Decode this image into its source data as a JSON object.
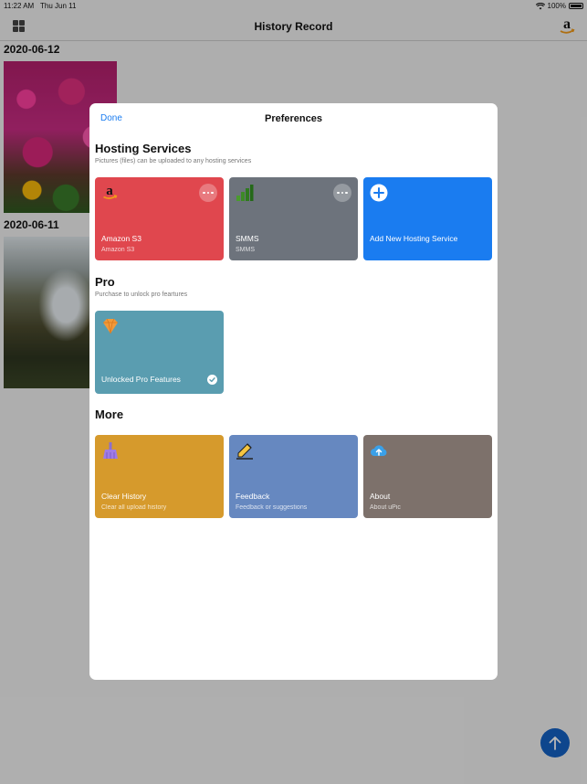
{
  "statusbar": {
    "time": "11:22 AM",
    "date": "Thu Jun 11",
    "battery": "100%"
  },
  "navbar": {
    "title": "History Record"
  },
  "history": {
    "dates": [
      "2020-06-12",
      "2020-06-11"
    ]
  },
  "modal": {
    "done_label": "Done",
    "title": "Preferences",
    "hosting": {
      "title": "Hosting Services",
      "subtitle": "Pictures (files) can be uploaded to any hosting services",
      "cards": [
        {
          "title": "Amazon S3",
          "subtitle": "Amazon S3",
          "color": "#e0474e",
          "icon": "amazon-icon"
        },
        {
          "title": "SMMS",
          "subtitle": "SMMS",
          "color": "#6d737c",
          "icon": "signal-bars-icon"
        },
        {
          "title": "Add New Hosting Service",
          "color": "#1a7cf0",
          "icon": "plus-circle-icon"
        }
      ]
    },
    "pro": {
      "title": "Pro",
      "subtitle": "Purchase to unlock pro feartures",
      "card": {
        "title": "Unlocked Pro Features",
        "color": "#5a9db0",
        "icon": "diamond-icon"
      }
    },
    "more": {
      "title": "More",
      "cards": [
        {
          "title": "Clear History",
          "subtitle": "Clear all upload history",
          "color": "#d69a2c",
          "icon": "broom-icon"
        },
        {
          "title": "Feedback",
          "subtitle": "Feedback or suggestions",
          "color": "#6688c0",
          "icon": "pencil-icon"
        },
        {
          "title": "About",
          "subtitle": "About uPic",
          "color": "#7d716b",
          "icon": "cloud-upload-icon"
        }
      ]
    }
  },
  "colors": {
    "accent": "#1a7cf0",
    "fab": "#1462c4"
  }
}
